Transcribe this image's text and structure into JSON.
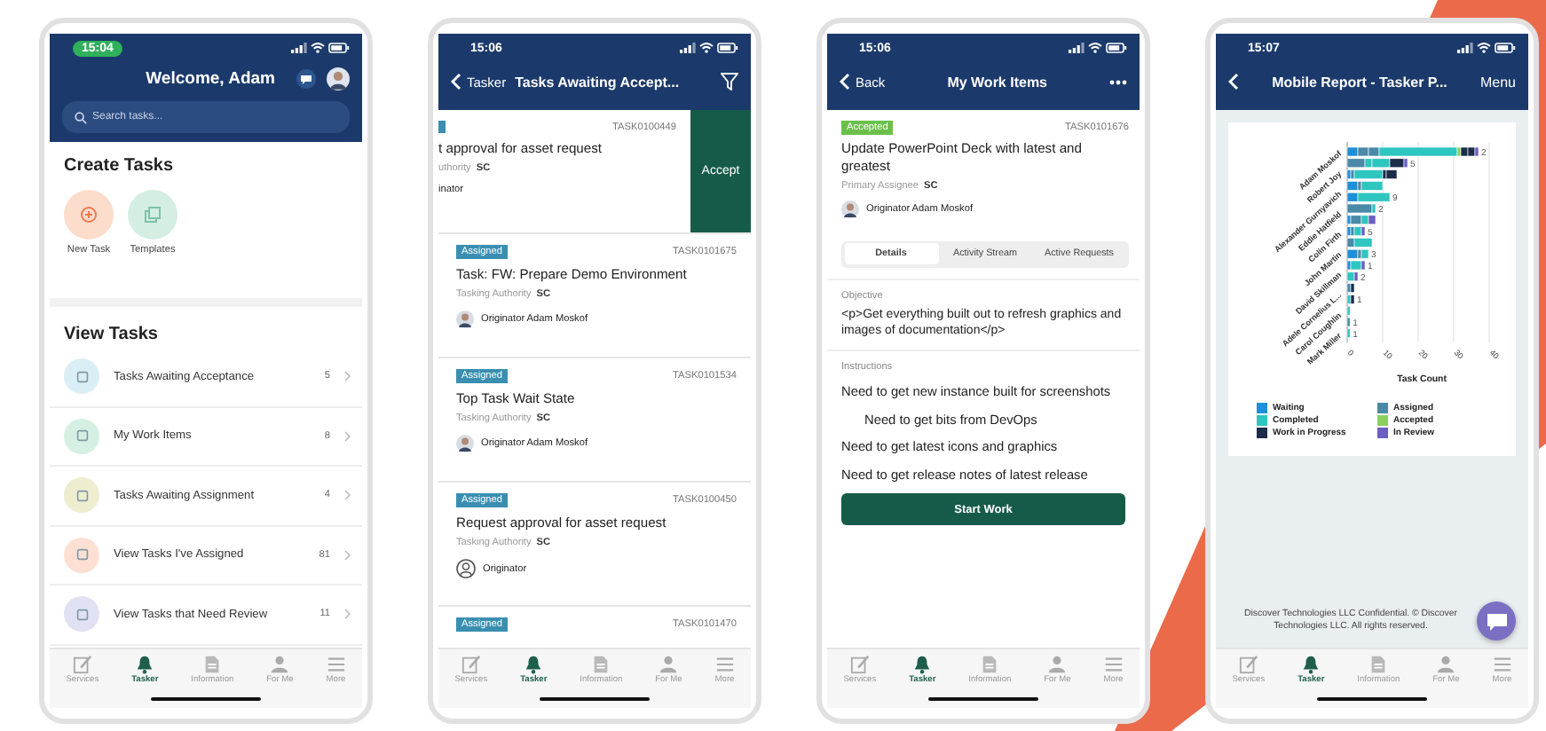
{
  "screens": [
    {
      "kind": "home",
      "status": {
        "time": "15:04",
        "highlighted": true
      },
      "title": "Welcome, Adam",
      "search": {
        "placeholder": "Search tasks..."
      },
      "create_heading": "Create Tasks",
      "create_actions": [
        {
          "label": "New Task",
          "color": "#fcdccb"
        },
        {
          "label": "Templates",
          "color": "#d4eee2"
        }
      ],
      "view_heading": "View Tasks",
      "view_items": [
        {
          "label": "Tasks Awaiting Acceptance",
          "count": "5",
          "color": "#d9eff5"
        },
        {
          "label": "My Work Items",
          "count": "8",
          "color": "#d6efe3"
        },
        {
          "label": "Tasks Awaiting Assignment",
          "count": "4",
          "color": "#efedcf"
        },
        {
          "label": "View Tasks I've Assigned",
          "count": "81",
          "color": "#fde0d3"
        },
        {
          "label": "View Tasks that Need Review",
          "count": "11",
          "color": "#e1e1f4"
        }
      ],
      "tab_bar": [
        {
          "label": "Services",
          "selected": false
        },
        {
          "label": "Tasker",
          "selected": true
        },
        {
          "label": "Information",
          "selected": false
        },
        {
          "label": "For Me",
          "selected": false
        },
        {
          "label": "More",
          "selected": false
        }
      ]
    },
    {
      "kind": "list",
      "status": {
        "time": "15:06",
        "highlighted": false
      },
      "back": "Tasker",
      "title": "Tasks Awaiting Accept...",
      "cards": [
        {
          "kind": "swiped",
          "task_id": "TASK0100449",
          "title": "t approval for asset request",
          "authority_label": "uthority",
          "authority": "SC",
          "originator": "inator",
          "action": "Accept"
        },
        {
          "kind": "normal",
          "status": "Assigned",
          "task_id": "TASK0101675",
          "title": "Task: FW: Prepare Demo Environment",
          "authority_label": "Tasking Authority",
          "authority": "SC",
          "originator": "Originator Adam Moskof",
          "has_photo": true
        },
        {
          "kind": "normal",
          "status": "Assigned",
          "task_id": "TASK0101534",
          "title": "Top Task Wait State",
          "authority_label": "Tasking Authority",
          "authority": "SC",
          "originator": "Originator Adam Moskof",
          "has_photo": true
        },
        {
          "kind": "normal",
          "status": "Assigned",
          "task_id": "TASK0100450",
          "title": "Request approval for asset request",
          "authority_label": "Tasking Authority",
          "authority": "SC",
          "originator": "Originator",
          "has_photo": false
        },
        {
          "kind": "normal",
          "status": "Assigned",
          "task_id": "TASK0101470"
        }
      ],
      "tab_bar": [
        {
          "label": "Services",
          "selected": false
        },
        {
          "label": "Tasker",
          "selected": true
        },
        {
          "label": "Information",
          "selected": false
        },
        {
          "label": "For Me",
          "selected": false
        },
        {
          "label": "More",
          "selected": false
        }
      ]
    },
    {
      "kind": "detail",
      "status": {
        "time": "15:06",
        "highlighted": false
      },
      "back": "Back",
      "title": "My Work Items",
      "task": {
        "status": "Accepted",
        "task_id": "TASK0101676",
        "title": "Update PowerPoint Deck with latest and greatest",
        "assignee_label": "Primary Assignee",
        "assignee": "SC",
        "originator": "Originator Adam Moskof"
      },
      "segments": [
        {
          "label": "Details",
          "selected": true
        },
        {
          "label": "Activity Stream",
          "selected": false
        },
        {
          "label": "Active Requests",
          "selected": false
        }
      ],
      "objective_label": "Objective",
      "objective": "<p>Get everything built out to refresh graphics and images of documentation</p>",
      "instructions_label": "Instructions",
      "instructions": [
        {
          "text": "Need to get new instance built for screenshots",
          "centered": false
        },
        {
          "text": "Need to get bits from DevOps",
          "centered": true
        },
        {
          "text": "Need to get latest icons and graphics",
          "centered": false
        },
        {
          "text": "Need to get release notes of latest release",
          "centered": false
        }
      ],
      "primary_button": "Start Work",
      "tab_bar": [
        {
          "label": "Services",
          "selected": false
        },
        {
          "label": "Tasker",
          "selected": true
        },
        {
          "label": "Information",
          "selected": false
        },
        {
          "label": "For Me",
          "selected": false
        },
        {
          "label": "More",
          "selected": false
        }
      ]
    },
    {
      "kind": "report",
      "status": {
        "time": "15:07",
        "highlighted": false
      },
      "title": "Mobile Report - Tasker P...",
      "menu": "Menu",
      "chart": {
        "row_labels": [
          "Adam Moskof",
          "Robert Joy",
          "Alexander Gurnyavich",
          "Eddie Hatfield",
          "Colin Firth",
          "John Martin",
          "David Skillman",
          "Adele Cornelius L...",
          "Carol Coughlin",
          "Mark Miller"
        ],
        "tick_labels": [
          "0",
          "10",
          "20",
          "30",
          "40"
        ],
        "xlabel": "Task Count",
        "bar_labels": [
          "2",
          "5",
          "9",
          "2",
          "5",
          "3",
          "1",
          "2",
          "1",
          "1",
          "1"
        ],
        "legend": [
          {
            "label": "Waiting",
            "color": "#1e8fd8"
          },
          {
            "label": "Assigned",
            "color": "#4a8aa8"
          },
          {
            "label": "Completed",
            "color": "#2ec6c0"
          },
          {
            "label": "Accepted",
            "color": "#8ccf5e"
          },
          {
            "label": "Work in Progress",
            "color": "#1c2d4a"
          },
          {
            "label": "In Review",
            "color": "#6b5fc2"
          }
        ]
      },
      "footer": "Discover Technologies LLC Confidential. © Discover Technologies LLC. All rights reserved.",
      "tab_bar": [
        {
          "label": "Services",
          "selected": false
        },
        {
          "label": "Tasker",
          "selected": true
        },
        {
          "label": "Information",
          "selected": false
        },
        {
          "label": "For Me",
          "selected": false
        },
        {
          "label": "More",
          "selected": false
        }
      ]
    }
  ]
}
